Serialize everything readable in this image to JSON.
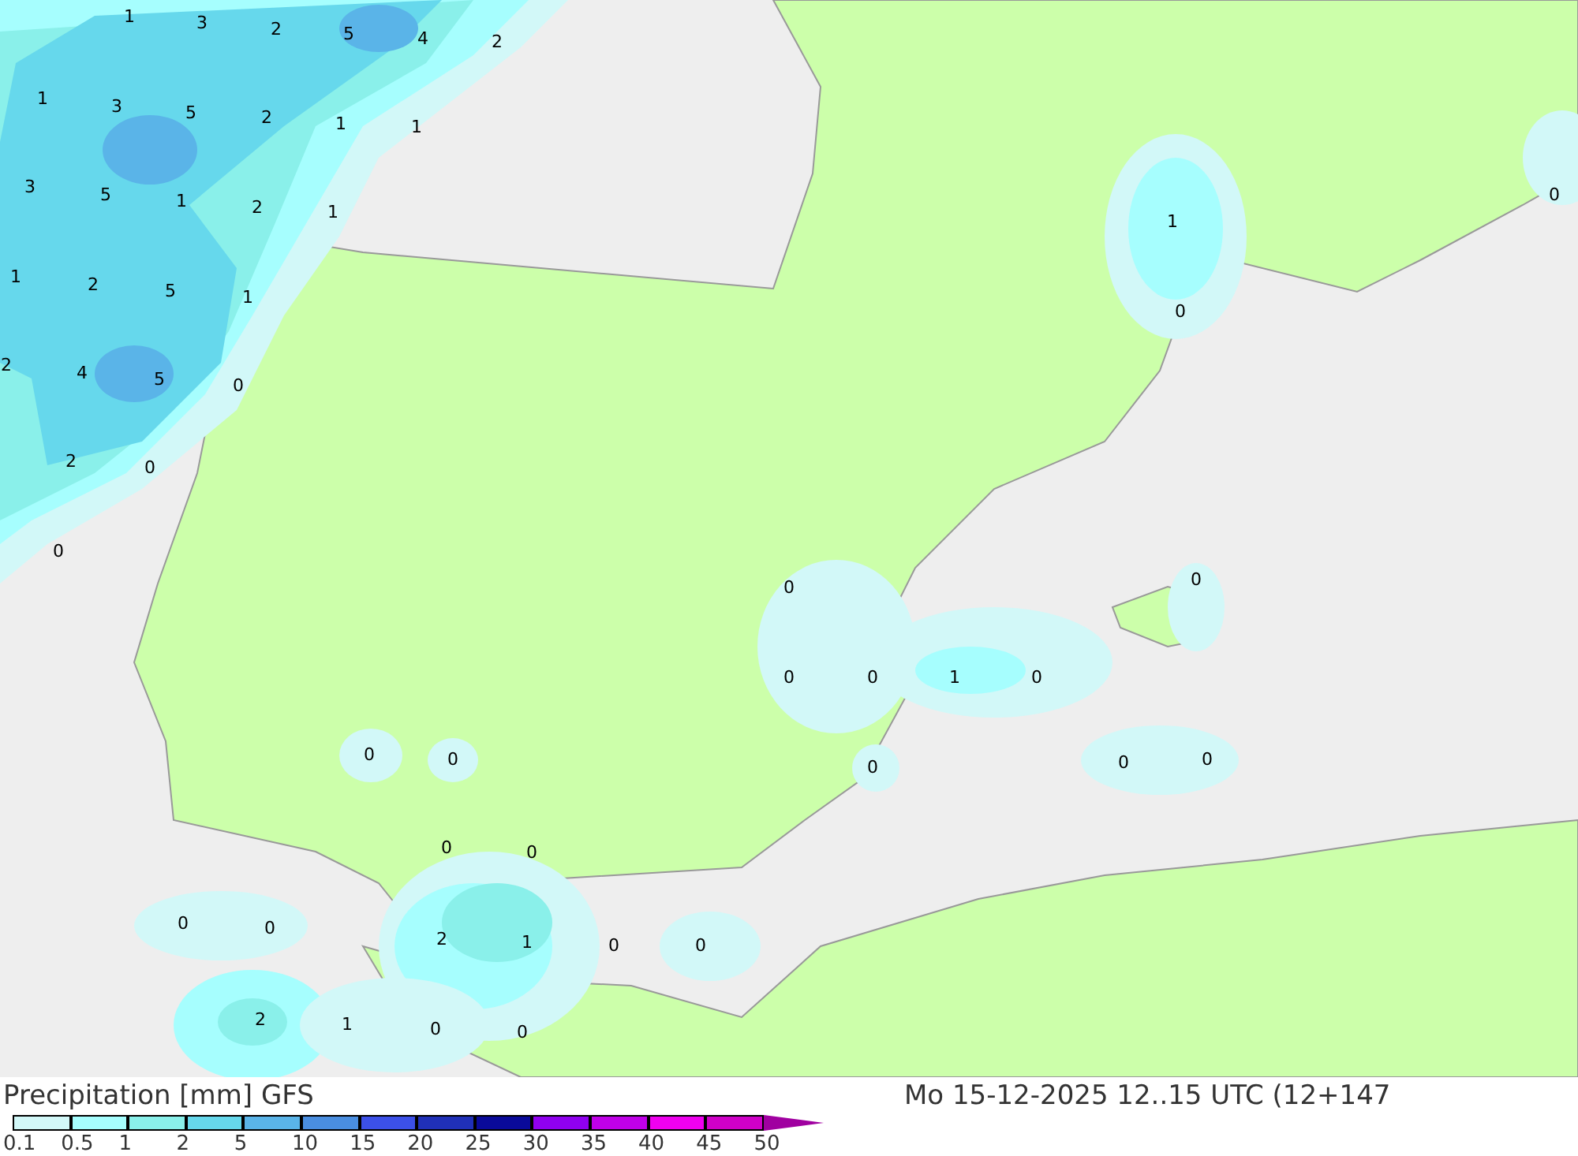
{
  "map": {
    "values": [
      "1",
      "3",
      "2",
      "5",
      "4",
      "2",
      "1",
      "3",
      "5",
      "2",
      "1",
      "1",
      "3",
      "5",
      "1",
      "2",
      "1",
      "1",
      "2",
      "5",
      "1",
      "2",
      "4",
      "5",
      "0",
      "2",
      "0",
      "0",
      "1",
      "0",
      "0",
      "0",
      "0",
      "0",
      "0",
      "1",
      "0",
      "0",
      "0",
      "0",
      "0",
      "0",
      "0",
      "0",
      "0",
      "0",
      "2",
      "1",
      "0",
      "0",
      "2",
      "1",
      "0",
      "0"
    ]
  },
  "footer": {
    "title": "Precipitation [mm] GFS",
    "valid_time": "Mo 15-12-2025 12..15 UTC (12+147",
    "legend": [
      {
        "label": "0.1",
        "color": "#d2f8f8",
        "kind": "cell"
      },
      {
        "label": "0.5",
        "color": "#a6fefe",
        "kind": "cell"
      },
      {
        "label": "1",
        "color": "#8af0ea",
        "kind": "cell"
      },
      {
        "label": "2",
        "color": "#66d8ec",
        "kind": "cell"
      },
      {
        "label": "5",
        "color": "#5ab4e8",
        "kind": "cell"
      },
      {
        "label": "10",
        "color": "#4a8ee0",
        "kind": "cell"
      },
      {
        "label": "15",
        "color": "#3c50e8",
        "kind": "cell"
      },
      {
        "label": "20",
        "color": "#2030b8",
        "kind": "cell"
      },
      {
        "label": "25",
        "color": "#0a0a9a",
        "kind": "cell"
      },
      {
        "label": "30",
        "color": "#9000f0",
        "kind": "cell"
      },
      {
        "label": "35",
        "color": "#c000e8",
        "kind": "cell"
      },
      {
        "label": "40",
        "color": "#f000f0",
        "kind": "cell"
      },
      {
        "label": "45",
        "color": "#d000c8",
        "kind": "cell"
      },
      {
        "label": "50",
        "color": "#a000a0",
        "kind": "arrow"
      }
    ]
  }
}
